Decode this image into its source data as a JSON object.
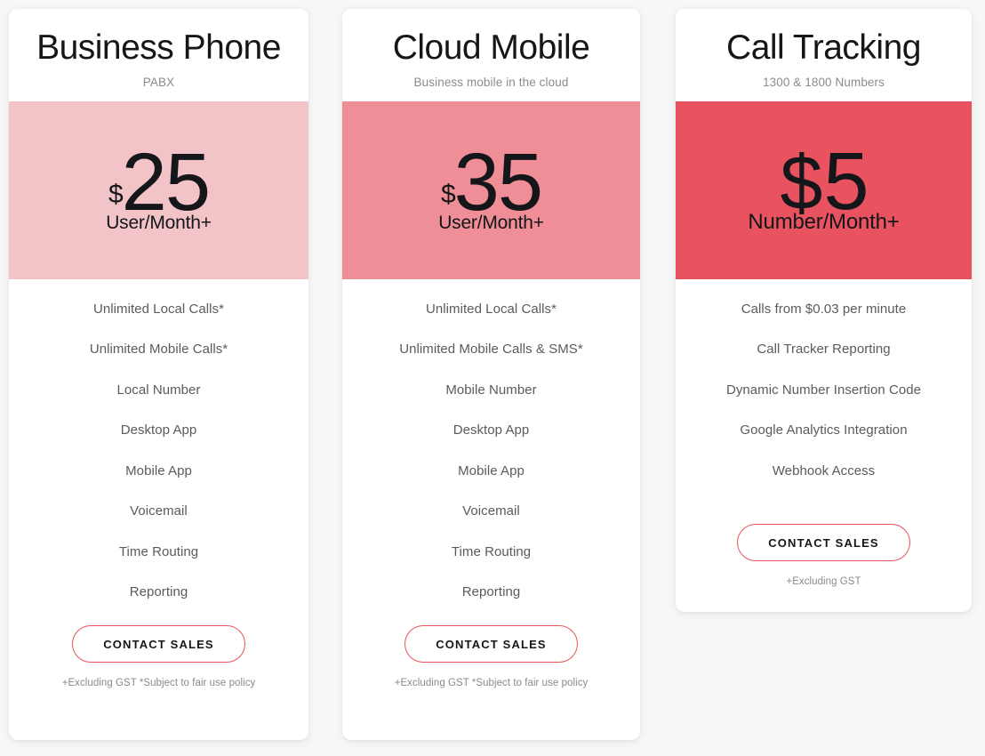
{
  "page": {
    "background_color": "#f7f7f7",
    "accent_color": "#e8535f"
  },
  "plans": [
    {
      "id": "business-phone",
      "title": "Business Phone",
      "subtitle": "PABX",
      "band_color": "#f2c4c8",
      "currency": "$",
      "amount": "25",
      "per": "User/Month+",
      "features": [
        "Unlimited Local Calls*",
        "Unlimited Mobile Calls*",
        "Local Number",
        "Desktop App",
        "Mobile App",
        "Voicemail",
        "Time Routing",
        "Reporting"
      ],
      "cta_label": "CONTACT SALES",
      "footnote": "+Excluding GST *Subject to fair use policy"
    },
    {
      "id": "cloud-mobile",
      "title": "Cloud Mobile",
      "subtitle": "Business mobile in the cloud",
      "band_color": "#ef8e96",
      "currency": "$",
      "amount": "35",
      "per": "User/Month+",
      "features": [
        "Unlimited Local Calls*",
        "Unlimited Mobile Calls & SMS*",
        "Mobile Number",
        "Desktop App",
        "Mobile App",
        "Voicemail",
        "Time Routing",
        "Reporting"
      ],
      "cta_label": "CONTACT SALES",
      "footnote": "+Excluding GST *Subject to fair use policy"
    },
    {
      "id": "call-tracking",
      "title": "Call Tracking",
      "subtitle": "1300 & 1800 Numbers",
      "band_color": "#e8535f",
      "currency": "$",
      "amount": "5",
      "per": "Number/Month+",
      "features": [
        "Calls from $0.03 per minute",
        "Call Tracker Reporting",
        "Dynamic Number Insertion Code",
        "Google Analytics Integration",
        "Webhook Access"
      ],
      "cta_label": "CONTACT SALES",
      "footnote": "+Excluding GST"
    }
  ]
}
